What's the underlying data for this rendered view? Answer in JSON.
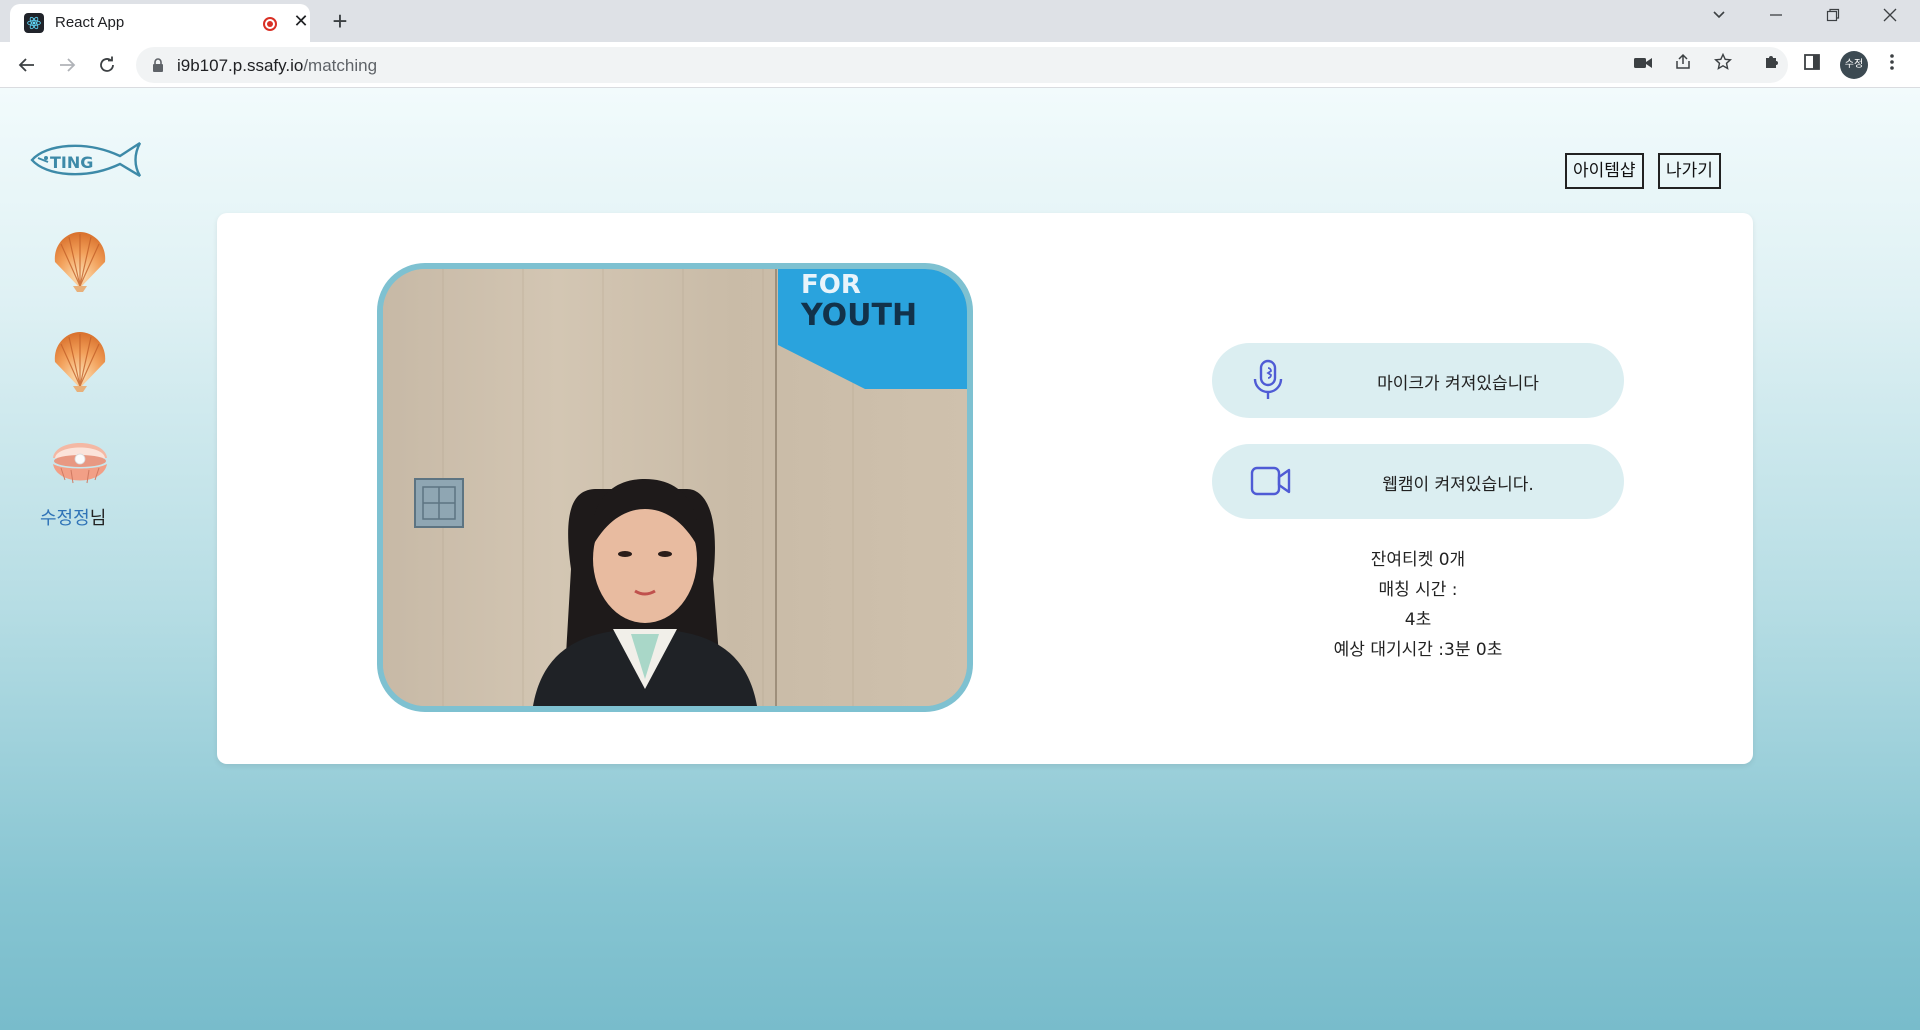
{
  "browser": {
    "tab_title": "React App",
    "url_host": "i9b107.p.ssafy.io",
    "url_path": "/matching",
    "profile_initials": "수정"
  },
  "page": {
    "logo_text": "TING",
    "top_buttons": {
      "item_shop": "아이템샵",
      "exit": "나가기"
    },
    "sidebar": {
      "user_name": "수정정",
      "user_suffix": "님"
    },
    "video": {
      "wall_sign_line1": "FOR",
      "wall_sign_line2": "YOUTH"
    },
    "mic_status": "마이크가 켜져있습니다",
    "webcam_status": "웹캠이 켜져있습니다.",
    "remaining_tickets": "잔여티켓 0개",
    "matching_time_label": "매칭 시간 :",
    "matching_time_value": "4초",
    "expected_wait": "예상 대기시간 :3분 0초"
  },
  "colors": {
    "accent_blue": "#2f73b7",
    "pill_bg": "#dbeef1",
    "video_border": "#7ec1d1",
    "icon_indigo": "#4f5bd5"
  }
}
